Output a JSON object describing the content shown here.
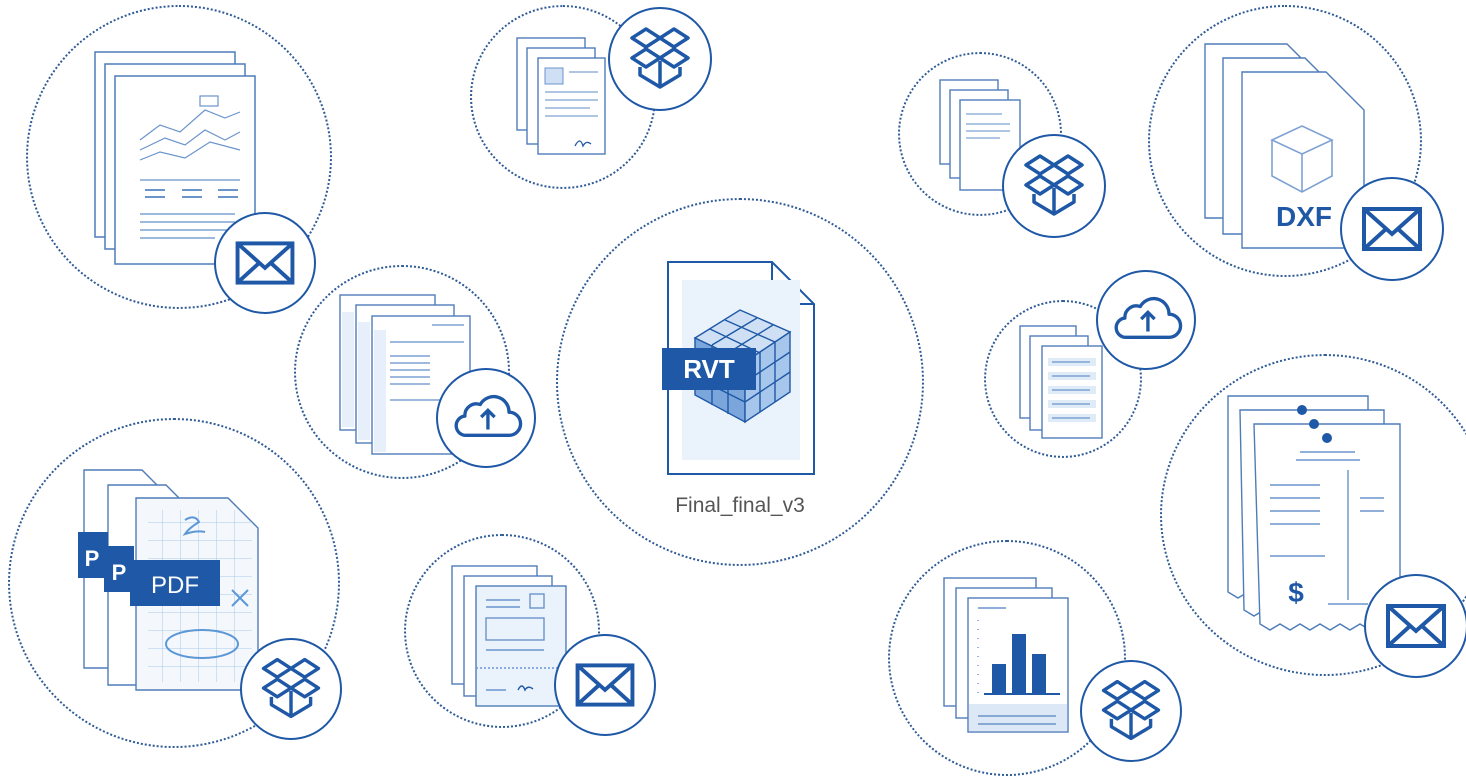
{
  "center": {
    "file_name": "Final_final_v3",
    "format_tag": "RVT"
  },
  "clusters": {
    "report_email": {
      "badge": "envelope-icon"
    },
    "contract_dropbox": {
      "badge": "dropbox-icon"
    },
    "form_upload": {
      "badge": "cloud-upload-icon"
    },
    "pdf_dropbox": {
      "badge": "dropbox-icon",
      "format_tag": "PDF",
      "stack_tag_initial": "P"
    },
    "invoice_email": {
      "badge": "envelope-icon"
    },
    "doc_dropbox": {
      "badge": "dropbox-icon"
    },
    "dxf_email": {
      "badge": "envelope-icon",
      "format_tag": "DXF"
    },
    "list_upload": {
      "badge": "cloud-upload-icon"
    },
    "bill_email": {
      "badge": "envelope-icon",
      "currency_symbol": "$"
    },
    "chart_dropbox": {
      "badge": "dropbox-icon"
    }
  },
  "colors": {
    "brand": "#1e58a6",
    "ring": "#2f5b96",
    "doc_stroke": "#5b86c0",
    "doc_fill_light": "#eaf2fb",
    "accent_light": "#a9c8ec"
  }
}
